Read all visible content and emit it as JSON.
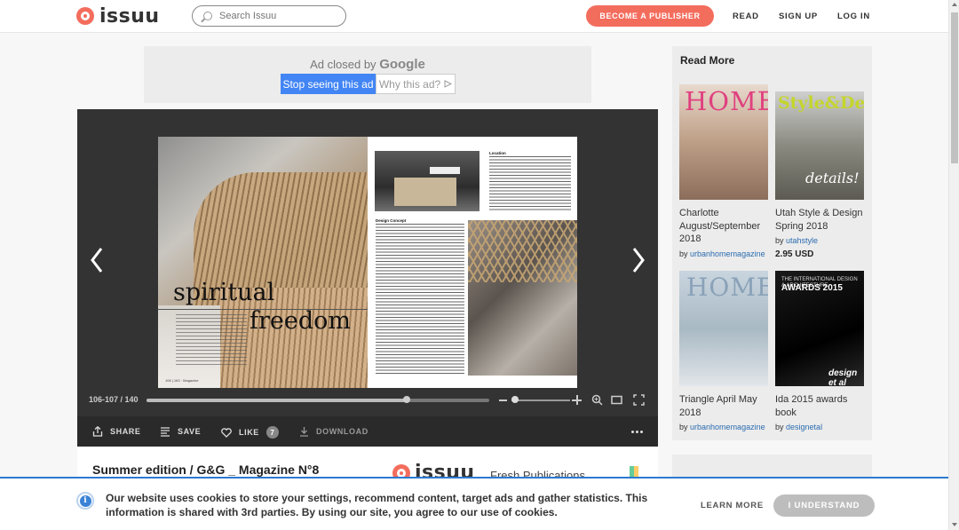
{
  "header": {
    "logo_text": "issuu",
    "search_placeholder": "Search Issuu",
    "become_publisher": "BECOME A PUBLISHER",
    "nav": [
      "READ",
      "SIGN UP",
      "LOG IN"
    ]
  },
  "ad": {
    "closed_by": "Ad closed by",
    "google": "Google",
    "stop_label": "Stop seeing this ad",
    "why_label": "Why this ad?"
  },
  "reader": {
    "spread_left": {
      "headline_1": "spiritual",
      "headline_2": "freedom",
      "footer": "106 | 163 · Magazine"
    },
    "spread_right": {
      "heading_location": "Location",
      "heading_design": "Design Concept"
    },
    "page_count": "106-107 / 140",
    "progress": 0.76,
    "zoom_level": 0.0,
    "actions": {
      "share": "SHARE",
      "save": "SAVE",
      "like": "LIKE",
      "like_count": "7",
      "download": "DOWNLOAD"
    }
  },
  "document": {
    "title": "Summer edition / G&G _ Magazine N°8",
    "promo_logo": "issuu",
    "promo_text": "Fresh Publications"
  },
  "sidebar": {
    "title": "Read More",
    "cards": [
      {
        "title": "Charlotte August/September 2018",
        "by_prefix": "by",
        "publisher": "urbanhomemagazine",
        "price": "",
        "cover_mast": "HOME"
      },
      {
        "title": "Utah Style & Design Spring 2018",
        "by_prefix": "by",
        "publisher": "utahstyle",
        "price": "2.95 USD",
        "cover_mast": "Style&Design",
        "cover_script": "details!"
      },
      {
        "title": "Triangle April May 2018",
        "by_prefix": "by",
        "publisher": "urbanhomemagazine",
        "price": "",
        "cover_mast": "HOME"
      },
      {
        "title": "Ida 2015 awards book",
        "by_prefix": "by",
        "publisher": "designetal",
        "price": "",
        "cover_top": "THE INTERNATIONAL DESIGN & ARCHITECTURE",
        "cover_big": "AWARDS 2015",
        "cover_brand": "design et al"
      }
    ]
  },
  "cookie": {
    "text": "Our website uses cookies to store your settings, recommend content, target ads and gather statistics. This information is shared with 3rd parties. By using our site, you agree to our use of cookies.",
    "learn_more": "LEARN MORE",
    "understand": "I UNDERSTAND",
    "info_glyph": "i"
  },
  "colors": {
    "brand": "#f36d5d",
    "link": "#2b6cb0",
    "ad_button": "#4285f4",
    "cookie_border": "#2b7bd1"
  }
}
